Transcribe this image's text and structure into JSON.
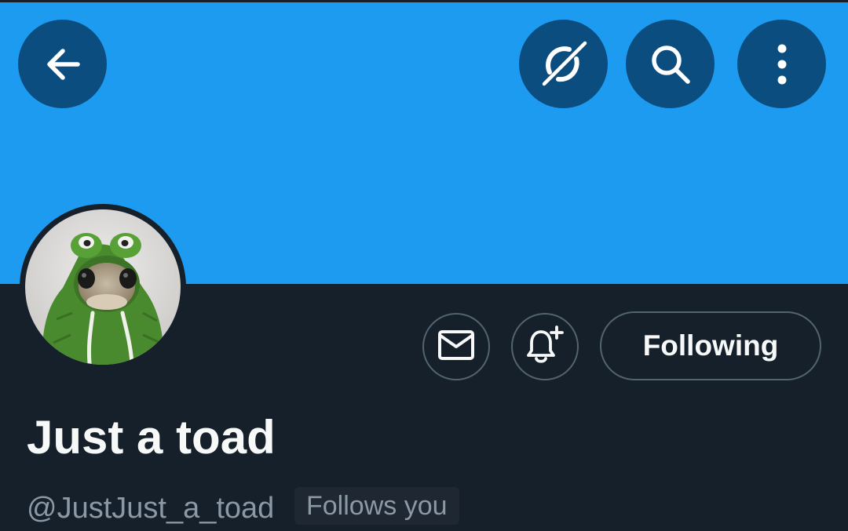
{
  "profile": {
    "display_name": "Just a toad",
    "handle": "@JustJust_a_toad",
    "follows_you": "Follows you",
    "avatar_icon": "knitted-frog-hood-toad"
  },
  "actions": {
    "following_label": "Following",
    "message_icon": "envelope-icon",
    "notify_icon": "bell-plus-icon"
  },
  "nav": {
    "back_icon": "arrow-left-icon",
    "explore_icon": "grok-icon",
    "search_icon": "search-icon",
    "more_icon": "vertical-dots-icon"
  },
  "colors": {
    "banner": "#1d9bf0",
    "background": "#15202b",
    "nav_button": "#0c4d80",
    "border": "#536471",
    "secondary_text": "#8b98a5",
    "primary_text": "#f7f9f9"
  }
}
